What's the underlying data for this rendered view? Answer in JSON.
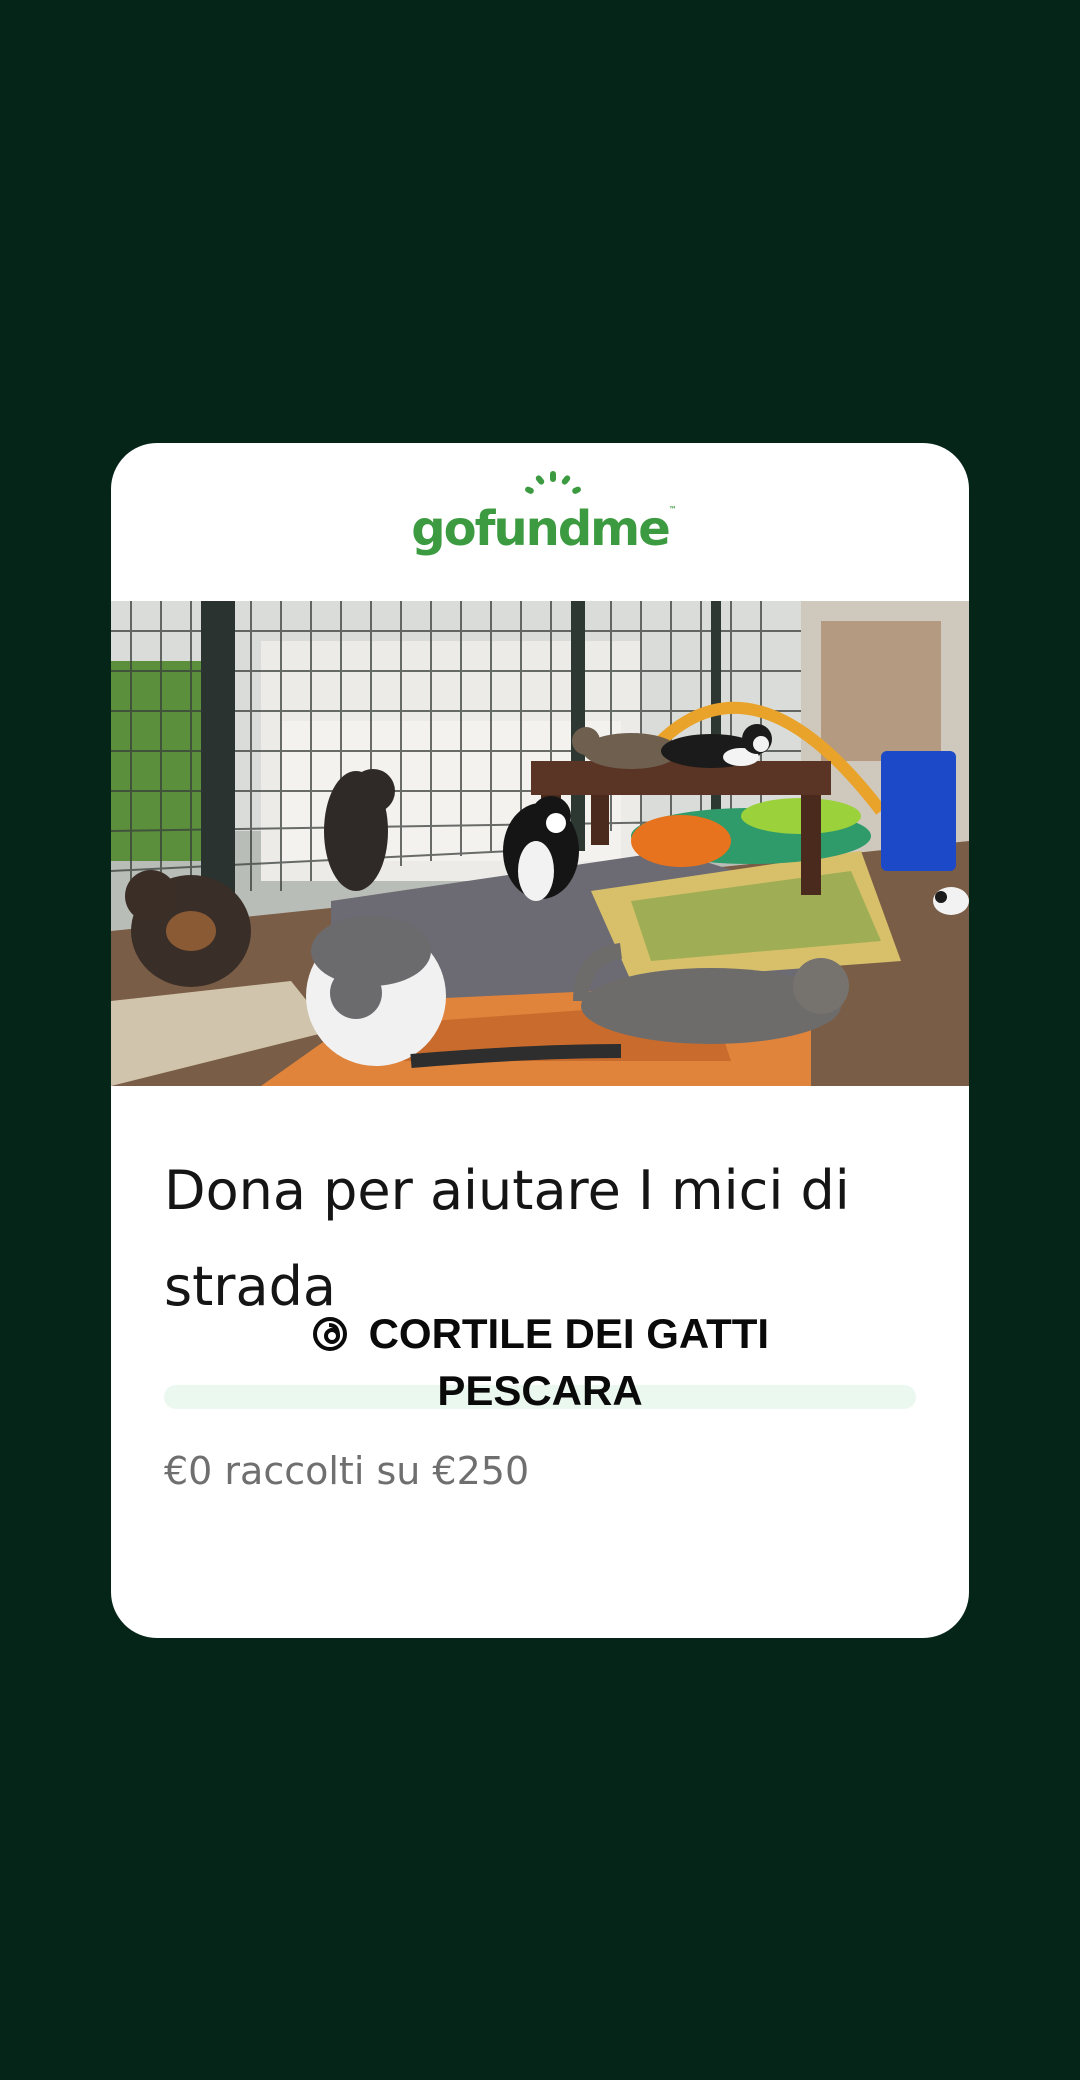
{
  "brand": {
    "name": "gofundme",
    "trademark": "™",
    "color": "#3c9a41"
  },
  "photo": {
    "subject": "cats in an outdoor enclosure"
  },
  "campaign": {
    "title": "Dona per aiutare I mici di strada",
    "raised_text": "€0 raccolti su €250",
    "progress_fraction": 0
  },
  "sticker": {
    "icon": "threads-icon",
    "text": "CORTILE DEI GATTI PESCARA"
  },
  "colors": {
    "background": "#062519",
    "card": "#ffffff",
    "progress_track": "#ebf8f0"
  }
}
